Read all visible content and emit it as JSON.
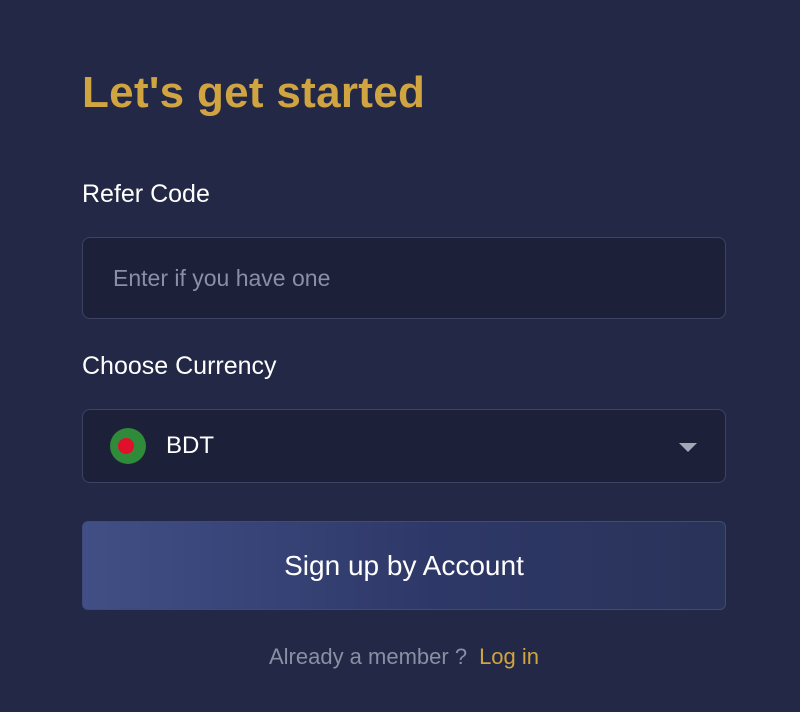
{
  "heading": "Let's get started",
  "refer": {
    "label": "Refer Code",
    "placeholder": "Enter if you have one",
    "value": ""
  },
  "currency": {
    "label": "Choose Currency",
    "selected": "BDT",
    "flag_icon": "bangladesh-flag-icon",
    "dropdown_icon": "caret-down-icon"
  },
  "signup_button": "Sign up by Account",
  "footer": {
    "prompt": "Already a member ?",
    "login_link": "Log in"
  },
  "colors": {
    "background": "#222845",
    "accent": "#d0a440",
    "field_background": "#1c2039",
    "field_border": "#3c4463",
    "button_gradient_start": "#414f86",
    "button_gradient_end": "#2a3358"
  }
}
